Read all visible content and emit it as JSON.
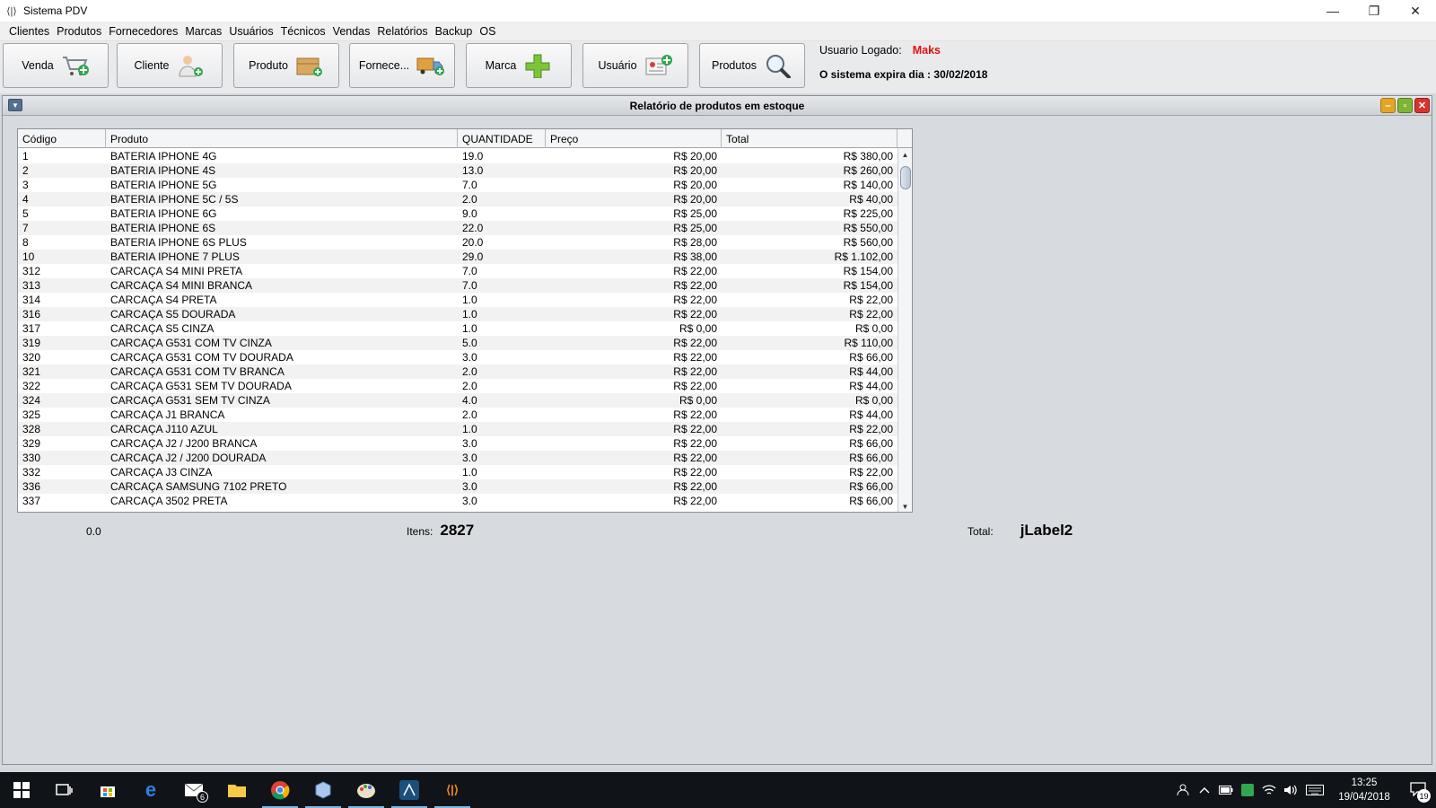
{
  "window": {
    "title": "Sistema PDV",
    "controls": [
      "—",
      "❐",
      "✕"
    ]
  },
  "menubar": {
    "items": [
      "Clientes",
      "Produtos",
      "Fornecedores",
      "Marcas",
      "Usuários",
      "Técnicos",
      "Vendas",
      "Relatórios",
      "Backup",
      "OS"
    ]
  },
  "toolbar": {
    "buttons": [
      {
        "label": "Venda",
        "icon": "cart-add-icon"
      },
      {
        "label": "Cliente",
        "icon": "user-add-icon"
      },
      {
        "label": "Produto",
        "icon": "box-add-icon"
      },
      {
        "label": "Fornece...",
        "icon": "truck-add-icon"
      },
      {
        "label": "Marca",
        "icon": "plus-icon"
      },
      {
        "label": "Usuário",
        "icon": "id-card-add-icon"
      },
      {
        "label": "Produtos",
        "icon": "magnifier-icon"
      }
    ],
    "user_label": "Usuario Logado:",
    "user_name": "Maks",
    "expiry": "O sistema expira dia : 30/02/2018",
    "user_name_color": "#e01010"
  },
  "report": {
    "title": "Relatório de produtos em estoque",
    "columns": [
      "Código",
      "Produto",
      "QUANTIDADE",
      "Preço",
      "Total"
    ],
    "rows": [
      [
        "1",
        "BATERIA IPHONE 4G",
        "19.0",
        "R$ 20,00",
        "R$ 380,00"
      ],
      [
        "2",
        "BATERIA IPHONE 4S",
        "13.0",
        "R$ 20,00",
        "R$ 260,00"
      ],
      [
        "3",
        "BATERIA IPHONE 5G",
        "7.0",
        "R$ 20,00",
        "R$ 140,00"
      ],
      [
        "4",
        "BATERIA IPHONE 5C / 5S",
        "2.0",
        "R$ 20,00",
        "R$ 40,00"
      ],
      [
        "5",
        "BATERIA IPHONE 6G",
        "9.0",
        "R$ 25,00",
        "R$ 225,00"
      ],
      [
        "7",
        "BATERIA IPHONE 6S",
        "22.0",
        "R$ 25,00",
        "R$ 550,00"
      ],
      [
        "8",
        "BATERIA IPHONE 6S PLUS",
        "20.0",
        "R$ 28,00",
        "R$ 560,00"
      ],
      [
        "10",
        "BATERIA IPHONE 7 PLUS",
        "29.0",
        "R$ 38,00",
        "R$ 1.102,00"
      ],
      [
        "312",
        "CARCAÇA S4 MINI PRETA",
        "7.0",
        "R$ 22,00",
        "R$ 154,00"
      ],
      [
        "313",
        "CARCAÇA S4 MINI  BRANCA",
        "7.0",
        "R$ 22,00",
        "R$ 154,00"
      ],
      [
        "314",
        "CARCAÇA S4 PRETA",
        "1.0",
        "R$ 22,00",
        "R$ 22,00"
      ],
      [
        "316",
        "CARCAÇA S5 DOURADA",
        "1.0",
        "R$ 22,00",
        "R$ 22,00"
      ],
      [
        "317",
        "CARCAÇA S5 CINZA",
        "1.0",
        "R$ 0,00",
        "R$ 0,00"
      ],
      [
        "319",
        "CARCAÇA G531 COM TV CINZA",
        "5.0",
        "R$ 22,00",
        "R$ 110,00"
      ],
      [
        "320",
        "CARCAÇA G531 COM TV DOURADA",
        "3.0",
        "R$ 22,00",
        "R$ 66,00"
      ],
      [
        "321",
        "CARCAÇA G531 COM TV BRANCA",
        "2.0",
        "R$ 22,00",
        "R$ 44,00"
      ],
      [
        "322",
        "CARCAÇA G531 SEM TV DOURADA",
        "2.0",
        "R$ 22,00",
        "R$ 44,00"
      ],
      [
        "324",
        "CARCAÇA G531 SEM TV CINZA",
        "4.0",
        "R$ 0,00",
        "R$ 0,00"
      ],
      [
        "325",
        "CARCAÇA J1 BRANCA",
        "2.0",
        "R$ 22,00",
        "R$ 44,00"
      ],
      [
        "328",
        "CARCAÇA J110 AZUL",
        "1.0",
        "R$ 22,00",
        "R$ 22,00"
      ],
      [
        "329",
        "CARCAÇA J2 / J200 BRANCA",
        "3.0",
        "R$ 22,00",
        "R$ 66,00"
      ],
      [
        "330",
        "CARCAÇA J2 / J200 DOURADA",
        "3.0",
        "R$ 22,00",
        "R$ 66,00"
      ],
      [
        "332",
        "CARCAÇA J3 CINZA",
        "1.0",
        "R$ 22,00",
        "R$ 22,00"
      ],
      [
        "336",
        "CARCAÇA SAMSUNG 7102 PRETO",
        "3.0",
        "R$ 22,00",
        "R$ 66,00"
      ],
      [
        "337",
        "CARCAÇA 3502 PRETA",
        "3.0",
        "R$ 22,00",
        "R$ 66,00"
      ]
    ],
    "footer": {
      "zero": "0.0",
      "itens_label": "Itens:",
      "itens_value": "2827",
      "total_label": "Total:",
      "total_value": "jLabel2"
    }
  },
  "taskbar": {
    "apps": [
      "windows-start-icon",
      "task-view-icon",
      "store-icon",
      "edge-icon",
      "mail-icon",
      "file-explorer-icon",
      "chrome-icon",
      "virtualbox-icon",
      "paint-icon",
      "netbeans-icon",
      "java-app-icon"
    ],
    "mail_badge": "6",
    "time": "13:25",
    "date": "19/04/2018",
    "notification_count": "19"
  }
}
